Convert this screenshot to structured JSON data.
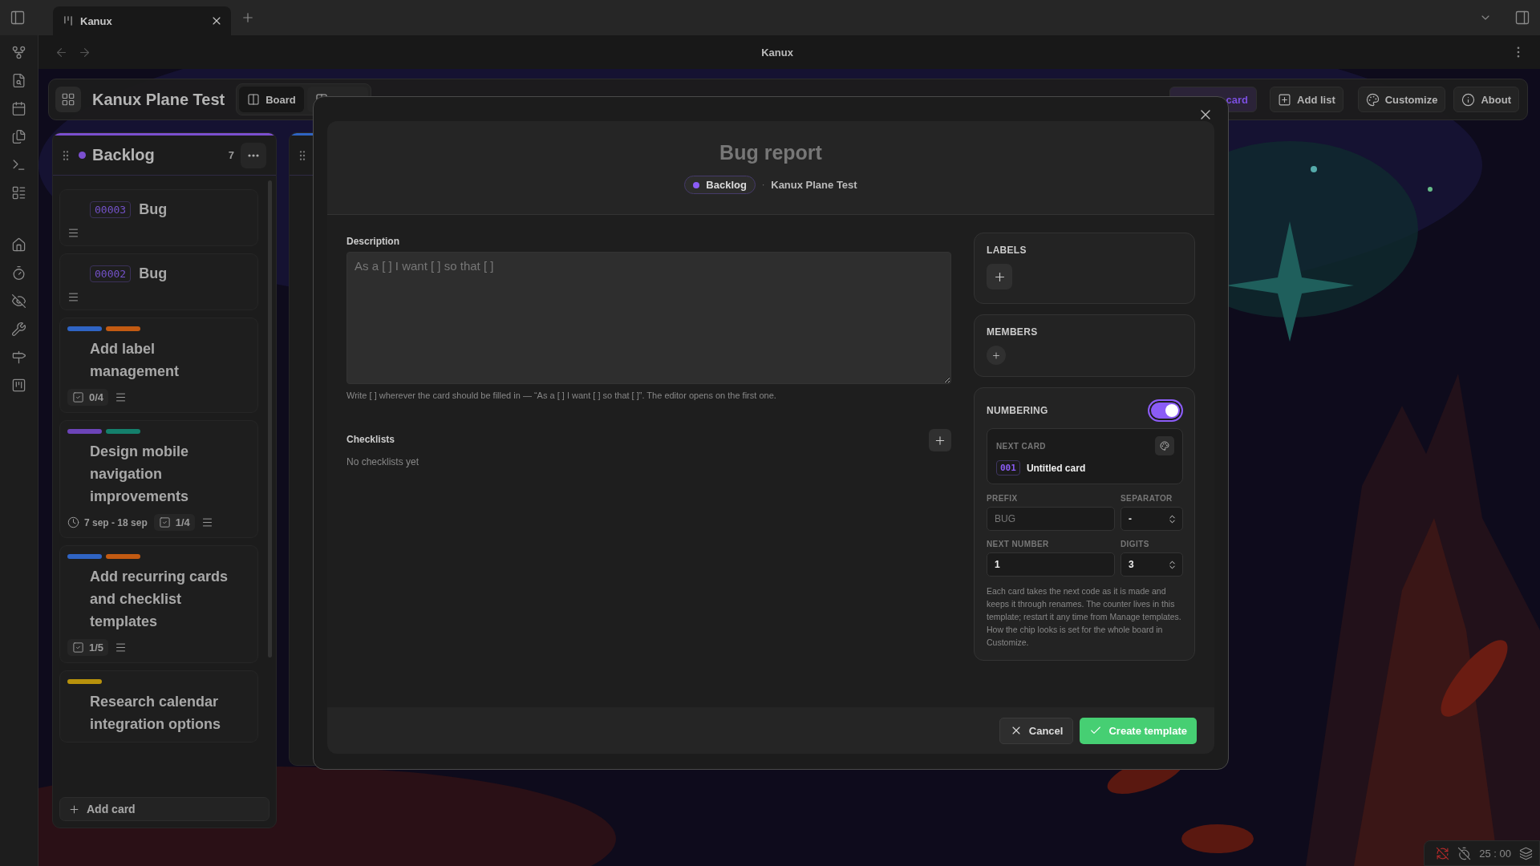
{
  "app_tabs": [
    {
      "title": "Kanux",
      "selected": true
    }
  ],
  "nav": {
    "title": "Kanux"
  },
  "board": {
    "title": "Kanux Plane Test",
    "views": [
      {
        "label": "Board",
        "selected": true
      },
      {
        "selected": false
      }
    ],
    "actions": [
      {
        "label": "card",
        "kind": "primary"
      },
      {
        "label": "Add list",
        "kind": "plain"
      },
      {
        "label": "Customize",
        "kind": "plain"
      },
      {
        "label": "About",
        "kind": "plain"
      }
    ]
  },
  "columns": [
    {
      "title": "Backlog",
      "color": "#7b4fd0",
      "count": "7",
      "add_label": "Add card",
      "cards": [
        {
          "code": "00003",
          "title": "Bug",
          "has_description": true
        },
        {
          "code": "00002",
          "title": "Bug",
          "has_description": true
        },
        {
          "labels": [
            {
              "color": "#2f64c4"
            },
            {
              "color": "#c25a12"
            }
          ],
          "title": "Add label management",
          "checklist": "0/4",
          "has_description": true
        },
        {
          "labels": [
            {
              "color": "#6c44b8"
            },
            {
              "color": "#14806c"
            }
          ],
          "title": "Design mobile navigation improvements",
          "dates": "7 sep - 18 sep",
          "checklist": "1/4",
          "has_description": true
        },
        {
          "labels": [
            {
              "color": "#2f64c4"
            },
            {
              "color": "#c25a12"
            }
          ],
          "title": "Add recurring cards and checklist templates",
          "checklist": "1/5",
          "has_description": true
        },
        {
          "labels": [
            {
              "color": "#b8920c"
            }
          ],
          "title": "Research calendar integration options"
        }
      ]
    },
    {
      "color": "#2f64c4"
    }
  ],
  "modal": {
    "title": "Bug report",
    "list": {
      "name": "Backlog",
      "color": "#8b5cf6"
    },
    "meta_separator": "·",
    "board": "Kanux Plane Test",
    "description": {
      "label": "Description",
      "placeholder": "As a [ ] I want [ ] so that [ ]",
      "hint": "Write [ ] wherever the card should be filled in — “As a [ ] I want [ ] so that [ ]”. The editor opens on the first one."
    },
    "checklists": {
      "label": "Checklists",
      "empty": "No checklists yet"
    },
    "labels": {
      "heading": "LABELS"
    },
    "members": {
      "heading": "MEMBERS"
    },
    "numbering": {
      "heading": "NUMBERING",
      "on": true,
      "next_card": {
        "label": "NEXT CARD",
        "code": "001",
        "title": "Untitled card"
      },
      "prefix": {
        "label": "PREFIX",
        "placeholder": "BUG"
      },
      "separator": {
        "label": "SEPARATOR",
        "value": "-"
      },
      "next_number": {
        "label": "NEXT NUMBER",
        "value": "1"
      },
      "digits": {
        "label": "DIGITS",
        "value": "3"
      },
      "note": "Each card takes the next code as it is made and keeps it through renames. The counter lives in this template; restart it any time from Manage templates. How the chip looks is set for the whole board in Customize."
    },
    "buttons": [
      {
        "label": "Cancel",
        "kind": "secondary"
      },
      {
        "label": "Create template",
        "kind": "primary"
      }
    ]
  },
  "status_bar": {
    "timer": "25 : 00"
  }
}
